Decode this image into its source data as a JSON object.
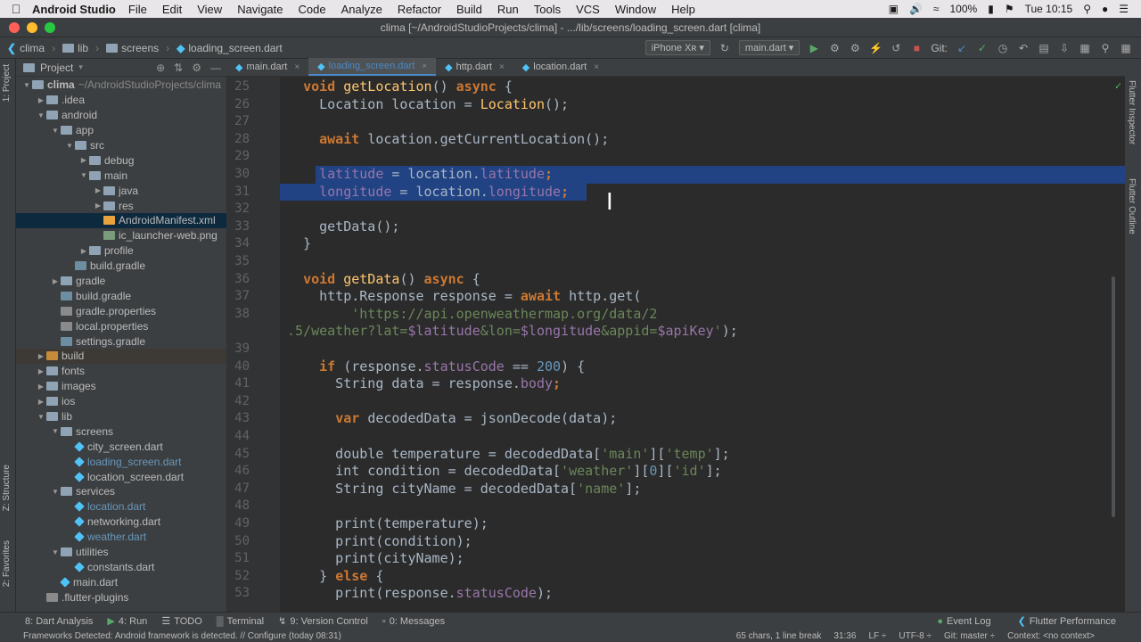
{
  "menubar": {
    "app": "Android Studio",
    "items": [
      "File",
      "Edit",
      "View",
      "Navigate",
      "Code",
      "Analyze",
      "Refactor",
      "Build",
      "Run",
      "Tools",
      "VCS",
      "Window",
      "Help"
    ],
    "battery": "100%",
    "clock": "Tue 10:15"
  },
  "window": {
    "title": "clima [~/AndroidStudioProjects/clima] - .../lib/screens/loading_screen.dart [clima]"
  },
  "nav": {
    "crumbs": [
      "clima",
      "lib",
      "screens",
      "loading_screen.dart"
    ],
    "device": "iPhone Xʀ",
    "config": "main.dart",
    "git_label": "Git:"
  },
  "left_strip": {
    "project": "1: Project",
    "structure": "Z: Structure",
    "favorites": "2: Favorites"
  },
  "project": {
    "header": "Project",
    "tree": [
      {
        "label": "clima",
        "hint": "~/AndroidStudioProjects/clima",
        "depth": 0,
        "open": true,
        "icon": "folder",
        "bold": true
      },
      {
        "label": ".idea",
        "depth": 1,
        "open": false,
        "icon": "folder"
      },
      {
        "label": "android",
        "depth": 1,
        "open": true,
        "icon": "folder"
      },
      {
        "label": "app",
        "depth": 2,
        "open": true,
        "icon": "folder"
      },
      {
        "label": "src",
        "depth": 3,
        "open": true,
        "icon": "folder"
      },
      {
        "label": "debug",
        "depth": 4,
        "open": false,
        "icon": "folder"
      },
      {
        "label": "main",
        "depth": 4,
        "open": true,
        "icon": "folder"
      },
      {
        "label": "java",
        "depth": 5,
        "open": false,
        "icon": "folder"
      },
      {
        "label": "res",
        "depth": 5,
        "open": false,
        "icon": "folder"
      },
      {
        "label": "AndroidManifest.xml",
        "depth": 5,
        "icon": "xml",
        "selected": true
      },
      {
        "label": "ic_launcher-web.png",
        "depth": 5,
        "icon": "png"
      },
      {
        "label": "profile",
        "depth": 4,
        "open": false,
        "icon": "folder"
      },
      {
        "label": "build.gradle",
        "depth": 3,
        "icon": "gradle"
      },
      {
        "label": "gradle",
        "depth": 2,
        "open": false,
        "icon": "folder"
      },
      {
        "label": "build.gradle",
        "depth": 2,
        "icon": "gradle"
      },
      {
        "label": "gradle.properties",
        "depth": 2,
        "icon": "props"
      },
      {
        "label": "local.properties",
        "depth": 2,
        "icon": "props"
      },
      {
        "label": "settings.gradle",
        "depth": 2,
        "icon": "gradle"
      },
      {
        "label": "build",
        "depth": 1,
        "open": false,
        "icon": "folder-orange",
        "highlight": true
      },
      {
        "label": "fonts",
        "depth": 1,
        "open": false,
        "icon": "folder"
      },
      {
        "label": "images",
        "depth": 1,
        "open": false,
        "icon": "folder"
      },
      {
        "label": "ios",
        "depth": 1,
        "open": false,
        "icon": "folder"
      },
      {
        "label": "lib",
        "depth": 1,
        "open": true,
        "icon": "folder"
      },
      {
        "label": "screens",
        "depth": 2,
        "open": true,
        "icon": "folder"
      },
      {
        "label": "city_screen.dart",
        "depth": 3,
        "icon": "dart"
      },
      {
        "label": "loading_screen.dart",
        "depth": 3,
        "icon": "dart",
        "modified": true
      },
      {
        "label": "location_screen.dart",
        "depth": 3,
        "icon": "dart"
      },
      {
        "label": "services",
        "depth": 2,
        "open": true,
        "icon": "folder"
      },
      {
        "label": "location.dart",
        "depth": 3,
        "icon": "dart",
        "modified": true
      },
      {
        "label": "networking.dart",
        "depth": 3,
        "icon": "dart"
      },
      {
        "label": "weather.dart",
        "depth": 3,
        "icon": "dart",
        "modified": true
      },
      {
        "label": "utilities",
        "depth": 2,
        "open": true,
        "icon": "folder"
      },
      {
        "label": "constants.dart",
        "depth": 3,
        "icon": "dart"
      },
      {
        "label": "main.dart",
        "depth": 2,
        "icon": "dart"
      },
      {
        "label": ".flutter-plugins",
        "depth": 1,
        "icon": "file"
      }
    ]
  },
  "tabs": [
    {
      "label": "main.dart",
      "active": false
    },
    {
      "label": "loading_screen.dart",
      "active": true
    },
    {
      "label": "http.dart",
      "active": false
    },
    {
      "label": "location.dart",
      "active": false
    }
  ],
  "code": {
    "selected_lines": [
      30,
      31
    ],
    "lines": [
      {
        "n": "25",
        "t": [
          [
            "  ",
            ""
          ],
          [
            "void ",
            "kw"
          ],
          [
            "getLocation",
            "fn"
          ],
          [
            "() ",
            ""
          ],
          [
            "async ",
            "kw"
          ],
          [
            "{",
            ""
          ]
        ]
      },
      {
        "n": "26",
        "t": [
          [
            "    Location location = ",
            ""
          ],
          [
            "Location",
            "fn"
          ],
          [
            "();",
            ""
          ]
        ]
      },
      {
        "n": "27",
        "t": []
      },
      {
        "n": "28",
        "t": [
          [
            "    ",
            ""
          ],
          [
            "await ",
            "kw"
          ],
          [
            "location.getCurrentLocation();",
            ""
          ]
        ]
      },
      {
        "n": "29",
        "t": []
      },
      {
        "n": "30",
        "t": [
          [
            "    ",
            ""
          ],
          [
            "latitude",
            "fld"
          ],
          [
            " = location.",
            ""
          ],
          [
            "latitude",
            "fld"
          ],
          [
            ";",
            "kw"
          ]
        ]
      },
      {
        "n": "31",
        "t": [
          [
            "    ",
            ""
          ],
          [
            "longitude",
            "fld"
          ],
          [
            " = location.",
            ""
          ],
          [
            "longitude",
            "fld"
          ],
          [
            ";",
            "kw"
          ]
        ]
      },
      {
        "n": "32",
        "t": []
      },
      {
        "n": "33",
        "t": [
          [
            "    getData();",
            ""
          ]
        ]
      },
      {
        "n": "34",
        "t": [
          [
            "  }",
            ""
          ]
        ]
      },
      {
        "n": "35",
        "t": []
      },
      {
        "n": "36",
        "t": [
          [
            "  ",
            ""
          ],
          [
            "void ",
            "kw"
          ],
          [
            "getData",
            "fn"
          ],
          [
            "() ",
            ""
          ],
          [
            "async ",
            "kw"
          ],
          [
            "{",
            ""
          ]
        ]
      },
      {
        "n": "37",
        "t": [
          [
            "    http.Response response = ",
            ""
          ],
          [
            "await ",
            "kw"
          ],
          [
            "http.get(",
            ""
          ]
        ]
      },
      {
        "n": "38",
        "t": [
          [
            "        ",
            ""
          ],
          [
            "'https://api.openweathermap.org/data/2",
            "str"
          ]
        ]
      },
      {
        "n": "",
        "t": [
          [
            "",
            ""
          ],
          [
            ".5/weather?lat=",
            "str"
          ],
          [
            "$latitude",
            "fld"
          ],
          [
            "&lon=",
            "str"
          ],
          [
            "$longitude",
            "fld"
          ],
          [
            "&appid=",
            "str"
          ],
          [
            "$apiKey",
            "fld"
          ],
          [
            "'",
            "str"
          ],
          [
            ");",
            ""
          ]
        ]
      },
      {
        "n": "39",
        "t": []
      },
      {
        "n": "40",
        "t": [
          [
            "    ",
            ""
          ],
          [
            "if ",
            "kw"
          ],
          [
            "(response.",
            ""
          ],
          [
            "statusCode",
            "fld"
          ],
          [
            " == ",
            ""
          ],
          [
            "200",
            "num"
          ],
          [
            ") {",
            ""
          ]
        ]
      },
      {
        "n": "41",
        "t": [
          [
            "      String data = response.",
            ""
          ],
          [
            "body",
            "fld"
          ],
          [
            ";",
            "kw"
          ]
        ]
      },
      {
        "n": "42",
        "t": []
      },
      {
        "n": "43",
        "t": [
          [
            "      ",
            ""
          ],
          [
            "var ",
            "kw"
          ],
          [
            "decodedData = jsonDecode(data);",
            ""
          ]
        ]
      },
      {
        "n": "44",
        "t": []
      },
      {
        "n": "45",
        "t": [
          [
            "      double temperature = decodedData[",
            ""
          ],
          [
            "'main'",
            "str"
          ],
          [
            "][",
            ""
          ],
          [
            "'temp'",
            "str"
          ],
          [
            "];",
            ""
          ]
        ]
      },
      {
        "n": "46",
        "t": [
          [
            "      int condition = decodedData[",
            ""
          ],
          [
            "'weather'",
            "str"
          ],
          [
            "][",
            ""
          ],
          [
            "0",
            "num"
          ],
          [
            "][",
            ""
          ],
          [
            "'id'",
            "str"
          ],
          [
            "];",
            ""
          ]
        ]
      },
      {
        "n": "47",
        "t": [
          [
            "      String cityName = decodedData[",
            ""
          ],
          [
            "'name'",
            "str"
          ],
          [
            "];",
            ""
          ]
        ]
      },
      {
        "n": "48",
        "t": []
      },
      {
        "n": "49",
        "t": [
          [
            "      print(temperature);",
            ""
          ]
        ]
      },
      {
        "n": "50",
        "t": [
          [
            "      print(condition);",
            ""
          ]
        ]
      },
      {
        "n": "51",
        "t": [
          [
            "      print(cityName);",
            ""
          ]
        ]
      },
      {
        "n": "52",
        "t": [
          [
            "    } ",
            ""
          ],
          [
            "else ",
            "kw"
          ],
          [
            "{",
            ""
          ]
        ]
      },
      {
        "n": "53",
        "t": [
          [
            "      print(response.",
            ""
          ],
          [
            "statusCode",
            "fld"
          ],
          [
            ");",
            ""
          ]
        ]
      }
    ]
  },
  "right_strip": {
    "inspector": "Flutter Inspector",
    "outline": "Flutter Outline"
  },
  "bottom": {
    "items": [
      "8: Dart Analysis",
      "4: Run",
      "TODO",
      "Terminal",
      "9: Version Control",
      "0: Messages"
    ],
    "right": [
      "Event Log",
      "Flutter Performance"
    ]
  },
  "status": {
    "message": "Frameworks Detected: Android framework is detected. // Configure (today 08:31)",
    "chars": "65 chars, 1 line break",
    "pos": "31:36",
    "lf": "LF ÷",
    "enc": "UTF-8 ÷",
    "git": "Git: master ÷",
    "context": "Context: <no context>"
  },
  "colors": {
    "accent": "#4a88c7",
    "selection": "#214283",
    "keyword": "#cc7832",
    "string": "#6a8759",
    "field": "#9876aa"
  }
}
